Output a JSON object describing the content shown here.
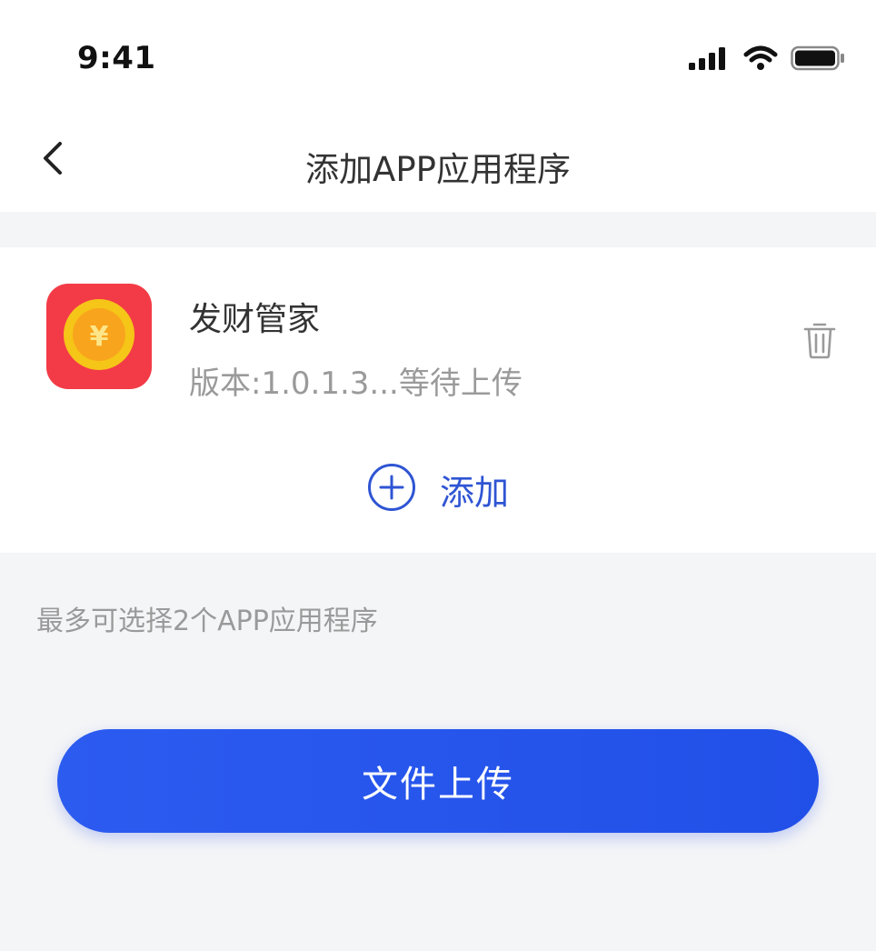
{
  "status_bar": {
    "time": "9:41",
    "icons": [
      "cellular-signal-icon",
      "wifi-icon",
      "battery-icon"
    ]
  },
  "nav": {
    "back_icon": "chevron-left-icon",
    "title": "添加APP应用程序"
  },
  "app_list": [
    {
      "icon": "coin-yuan-icon",
      "name": "发财管家",
      "subtitle": "版本:1.0.1.3...等待上传",
      "delete_icon": "trash-icon"
    }
  ],
  "add": {
    "icon": "plus-circle-icon",
    "label": "添加"
  },
  "hint": "最多可选择2个APP应用程序",
  "upload_button": {
    "label": "文件上传"
  },
  "colors": {
    "accent": "#2f55d4",
    "button": "#2150e8",
    "app_icon_bg": "#f33b47",
    "coin": "#f5c518",
    "background": "#f4f5f7"
  }
}
